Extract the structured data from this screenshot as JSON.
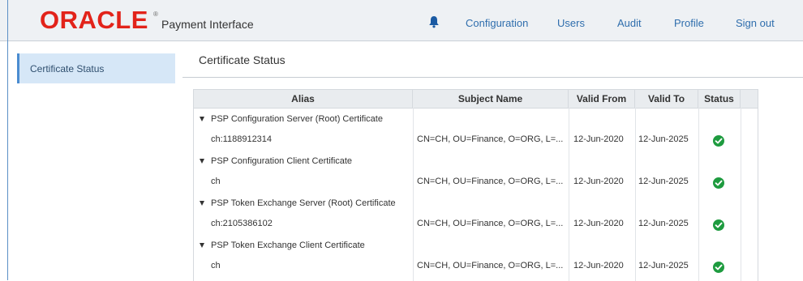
{
  "header": {
    "logo_text": "ORACLE",
    "logo_mark": "®",
    "app_title": "Payment Interface",
    "notification_icon": "bell-icon",
    "nav": [
      {
        "label": "Configuration"
      },
      {
        "label": "Users"
      },
      {
        "label": "Audit"
      },
      {
        "label": "Profile"
      },
      {
        "label": "Sign out"
      }
    ]
  },
  "sidebar": {
    "items": [
      {
        "label": "Certificate Status",
        "selected": true
      }
    ]
  },
  "main": {
    "title": "Certificate Status",
    "table": {
      "columns": [
        "Alias",
        "Subject Name",
        "Valid From",
        "Valid To",
        "Status"
      ],
      "groups": [
        {
          "label": "PSP Configuration Server (Root) Certificate",
          "row": {
            "alias": "ch:1188912314",
            "subject": "CN=CH, OU=Finance, O=ORG, L=...",
            "valid_from": "12-Jun-2020",
            "valid_to": "12-Jun-2025",
            "status": "ok"
          }
        },
        {
          "label": "PSP Configuration Client Certificate",
          "row": {
            "alias": "ch",
            "subject": "CN=CH, OU=Finance, O=ORG, L=...",
            "valid_from": "12-Jun-2020",
            "valid_to": "12-Jun-2025",
            "status": "ok"
          }
        },
        {
          "label": "PSP Token Exchange Server (Root) Certificate",
          "row": {
            "alias": "ch:2105386102",
            "subject": "CN=CH, OU=Finance, O=ORG, L=...",
            "valid_from": "12-Jun-2020",
            "valid_to": "12-Jun-2025",
            "status": "ok"
          }
        },
        {
          "label": "PSP Token Exchange Client Certificate",
          "row": {
            "alias": "ch",
            "subject": "CN=CH, OU=Finance, O=ORG, L=...",
            "valid_from": "12-Jun-2020",
            "valid_to": "12-Jun-2025",
            "status": "ok"
          }
        }
      ]
    }
  },
  "colors": {
    "brand": "#e2231a",
    "link": "#2f6ead",
    "selected_bg": "#d6e7f7",
    "status_ok": "#1e9b3f"
  }
}
